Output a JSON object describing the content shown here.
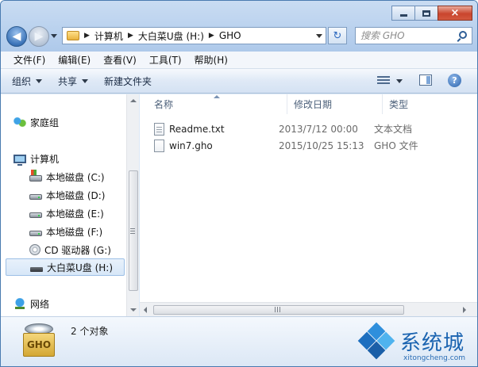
{
  "window": {
    "caption_close": "×"
  },
  "nav": {
    "back_arrow": "◀",
    "forward_arrow": "▶",
    "refresh_glyph": "↻"
  },
  "address": {
    "crumbs": [
      "计算机",
      "大白菜U盘 (H:)",
      "GHO"
    ],
    "separator": "▶"
  },
  "search": {
    "placeholder": "搜索 GHO"
  },
  "menu": {
    "items": [
      "文件(F)",
      "编辑(E)",
      "查看(V)",
      "工具(T)",
      "帮助(H)"
    ]
  },
  "commands": {
    "organize": "组织",
    "share": "共享",
    "new_folder": "新建文件夹",
    "help_glyph": "?"
  },
  "sidebar": {
    "items": [
      {
        "label": "家庭组",
        "icon": "homegroup-icon"
      },
      {
        "label": "计算机",
        "icon": "computer-icon"
      },
      {
        "label": "本地磁盘 (C:)",
        "icon": "system-drive-icon"
      },
      {
        "label": "本地磁盘 (D:)",
        "icon": "hard-drive-icon"
      },
      {
        "label": "本地磁盘 (E:)",
        "icon": "hard-drive-icon"
      },
      {
        "label": "本地磁盘 (F:)",
        "icon": "hard-drive-icon"
      },
      {
        "label": "CD 驱动器 (G:)",
        "icon": "cd-drive-icon"
      },
      {
        "label": "大白菜U盘 (H:)",
        "icon": "usb-drive-icon",
        "selected": true
      },
      {
        "label": "网络",
        "icon": "network-icon"
      }
    ]
  },
  "files": {
    "columns": {
      "name": "名称",
      "date": "修改日期",
      "type": "类型"
    },
    "rows": [
      {
        "name": "Readme.txt",
        "date": "2013/7/12 00:00",
        "type": "文本文档",
        "icon": "text-file-icon"
      },
      {
        "name": "win7.gho",
        "date": "2015/10/25 15:13",
        "type": "GHO 文件",
        "icon": "file-icon"
      }
    ]
  },
  "details": {
    "count": "2 个对象",
    "icon_label": "GHO"
  },
  "watermark": {
    "title": "系统城",
    "url": "xitongcheng.com"
  },
  "colors": {
    "titlebar": "#b9d1ee",
    "close_button": "#c9452d",
    "selection": "#d7e7f8"
  }
}
